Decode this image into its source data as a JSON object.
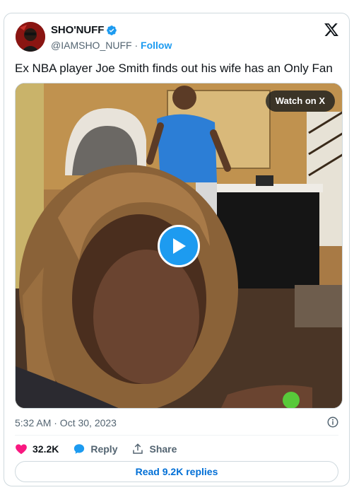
{
  "author": {
    "display_name": "SHO'NUFF",
    "handle": "@IAMSHO_NUFF",
    "separator": "·",
    "follow_label": "Follow",
    "verified_color": "#1d9bf0"
  },
  "tweet": {
    "text": "Ex NBA player Joe Smith finds out his wife has an Only Fan"
  },
  "media": {
    "watch_label": "Watch on X",
    "play_icon": "play-icon"
  },
  "meta": {
    "timestamp": "5:32 AM · Oct 30, 2023"
  },
  "actions": {
    "likes": "32.2K",
    "reply_label": "Reply",
    "share_label": "Share"
  },
  "footer": {
    "read_replies_label": "Read 9.2K replies"
  },
  "colors": {
    "like": "#f91880",
    "accent": "#1d9bf0",
    "link": "#006fd6"
  }
}
